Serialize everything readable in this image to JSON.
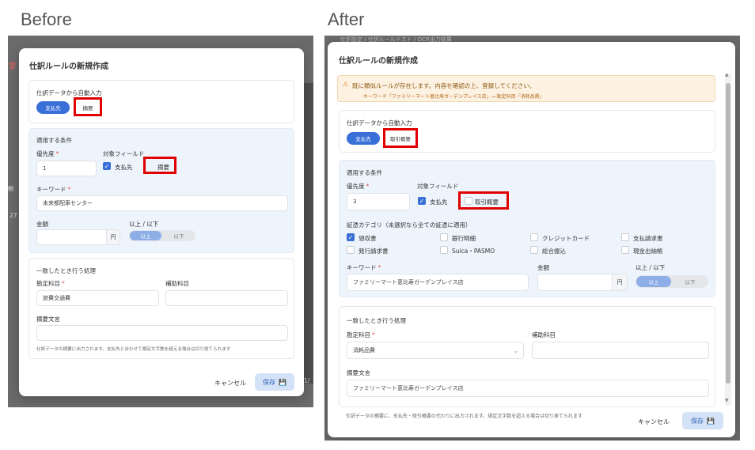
{
  "headings": {
    "before": "Before",
    "after": "After"
  },
  "before": {
    "title": "仕訳ルールの新規作成",
    "autofill": {
      "label": "仕訳データから自動入力",
      "chip_on": "支払先",
      "chip_off": "摘要"
    },
    "conditions": {
      "section_label": "適用する条件",
      "priority_label": "優先度",
      "priority_value": "1",
      "field_label": "対象フィールド",
      "field_payee": "支払先",
      "field_summary": "摘要",
      "keyword_label": "キーワード",
      "keyword_value": "未来都配車センター",
      "amount_label": "金額",
      "unit": "円",
      "compare_label": "以上 / 以下",
      "compare_gte": "以上",
      "compare_lte": "以下"
    },
    "action": {
      "section_label": "一致したとき行う処理",
      "account_label": "勘定科目",
      "account_value": "旅費交通費",
      "sub_label": "補助科目",
      "memo_label": "摘要文言",
      "note": "仕訳データの摘要に出力されます。支払先と合わせて規定文字数を超える場合は切り捨てられます"
    },
    "cancel": "キャンセル",
    "save": "保存",
    "bg_fragments": [
      "帳",
      "27",
      "1/"
    ]
  },
  "after": {
    "breadcrumb": "仕訳設定 / 仕訳ルールテスト / OCR出力結果",
    "title": "仕訳ルールの新規作成",
    "warning": {
      "line1": "既に類似ルールが存在します。内容を確認の上、登録してください。",
      "line2": "キーワード「ファミリーマート恵比寿ガーデンプレイス店」→ 勘定科目「消耗品費」"
    },
    "autofill": {
      "label": "仕訳データから自動入力",
      "chip_on": "支払先",
      "chip_off": "取引概要"
    },
    "conditions": {
      "section_label": "適用する条件",
      "priority_label": "優先度",
      "priority_value": "3",
      "field_label": "対象フィールド",
      "field_payee": "支払先",
      "field_summary": "取引概要",
      "category_label": "証憑カテゴリ（未選択なら全ての証憑に適用）",
      "categories": [
        "領収書",
        "銀行明細",
        "クレジットカード",
        "支払請求書",
        "発行請求書",
        "Suica・PASMO",
        "総合振込",
        "現金出納帳"
      ],
      "keyword_label": "キーワード",
      "keyword_value": "ファミリーマート恵比寿ガーデンプレイス店",
      "amount_label": "金額",
      "unit": "円",
      "compare_label": "以上 / 以下",
      "compare_gte": "以上",
      "compare_lte": "以下"
    },
    "action": {
      "section_label": "一致したとき行う処理",
      "account_label": "勘定科目",
      "account_value": "消耗品費",
      "sub_label": "補助科目",
      "memo_label": "摘要文言",
      "memo_value": "ファミリーマート恵比寿ガーデンプレイス店",
      "note": "仕訳データの摘要に、支払先・取引概要の代わりに出力されます。規定文字数を超える場合は切り捨てられます"
    },
    "cancel": "キャンセル",
    "save": "保存"
  },
  "colors": {
    "primary": "#3a6fd8",
    "highlight": "#e00000",
    "warning_bg": "#fdf1e1",
    "section_bg": "#eef4fb"
  }
}
